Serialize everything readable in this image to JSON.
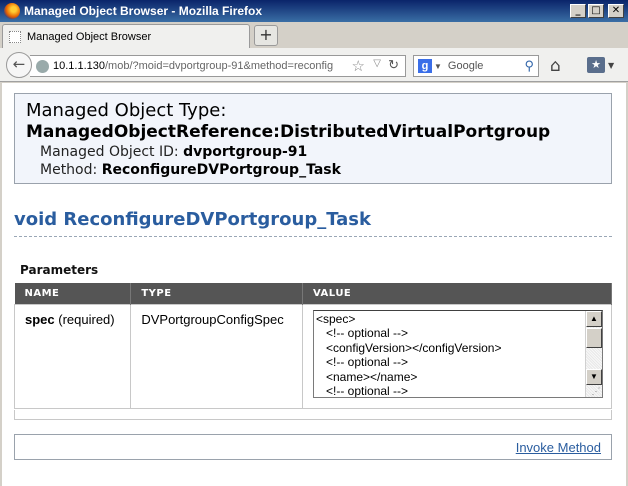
{
  "window": {
    "title": "Managed Object Browser - Mozilla Firefox",
    "buttons": {
      "minimize": "_",
      "maximize": "□",
      "close": "✕"
    }
  },
  "tabs": [
    {
      "label": "Managed Object Browser"
    }
  ],
  "new_tab_label": "+",
  "nav": {
    "url_host": "10.1.1.130",
    "url_path": "/mob/?moid=dvportgroup-91&method=reconfig",
    "search_placeholder": "Google",
    "icons": [
      "back-icon",
      "globe-icon",
      "star-icon",
      "dropdown-icon",
      "reload-icon",
      "google-icon",
      "search-icon",
      "home-icon",
      "bookmarks-icon"
    ]
  },
  "header": {
    "type_label": "Managed Object Type:",
    "type_value": "ManagedObjectReference:DistributedVirtualPortgroup",
    "id_label": "Managed Object ID:",
    "id_value": "dvportgroup-91",
    "method_label": "Method:",
    "method_value": "ReconfigureDVPortgroup_Task"
  },
  "method_signature": "void ReconfigureDVPortgroup_Task",
  "params_heading": "Parameters",
  "table": {
    "columns": [
      "NAME",
      "TYPE",
      "VALUE"
    ],
    "rows": [
      {
        "name": "spec",
        "qualifier": "(required)",
        "type": "DVPortgroupConfigSpec",
        "value_lines": [
          "<spec>",
          "   <!-- optional -->",
          "   <configVersion></configVersion>",
          "   <!-- optional -->",
          "   <name></name>",
          "   <!-- optional -->"
        ]
      }
    ]
  },
  "invoke_label": "Invoke Method",
  "colors": {
    "title_bar": "#0a246a",
    "method_title": "#2a5d9f",
    "table_header": "#555555",
    "header_box_bg": "#f2f5fb"
  }
}
